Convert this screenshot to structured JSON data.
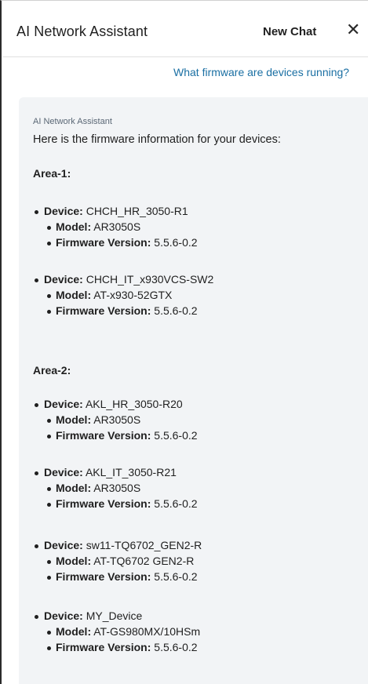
{
  "header": {
    "title": "AI Network Assistant",
    "new_chat_label": "New Chat",
    "close_glyph": "✕"
  },
  "user_message": "What firmware are devices running?",
  "reply": {
    "sender": "AI Network Assistant",
    "intro": "Here is the firmware information for your devices:",
    "labels": {
      "device": "Device:",
      "model": "Model:",
      "firmware": "Firmware Version:"
    },
    "areas": [
      {
        "heading": "Area-1:",
        "devices": [
          {
            "name": "CHCH_HR_3050-R1",
            "model": "AR3050S",
            "firmware": "5.5.6-0.2"
          },
          {
            "name": "CHCH_IT_x930VCS-SW2",
            "model": "AT-x930-52GTX",
            "firmware": "5.5.6-0.2"
          }
        ]
      },
      {
        "heading": "Area-2:",
        "devices": [
          {
            "name": "AKL_HR_3050-R20",
            "model": "AR3050S",
            "firmware": "5.5.6-0.2"
          },
          {
            "name": "AKL_IT_3050-R21",
            "model": "AR3050S",
            "firmware": "5.5.6-0.2"
          },
          {
            "name": "sw11-TQ6702_GEN2-R",
            "model": "AT-TQ6702 GEN2-R",
            "firmware": "5.5.6-0.2"
          },
          {
            "name": "MY_Device",
            "model": "AT-GS980MX/10HSm",
            "firmware": "5.5.6-0.2"
          }
        ]
      }
    ]
  }
}
